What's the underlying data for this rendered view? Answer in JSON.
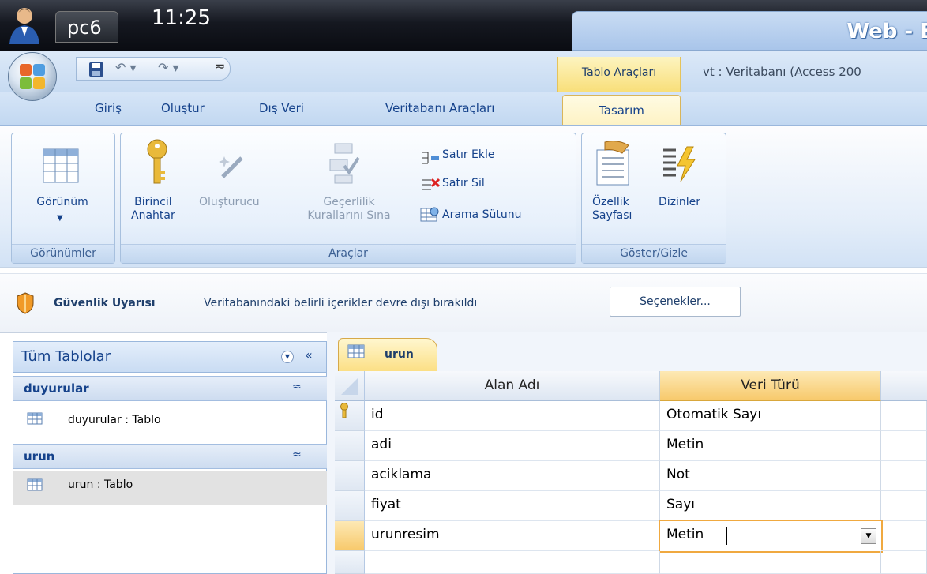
{
  "taskbar": {
    "host": "pc6",
    "clock": "11:25",
    "window_title": "Web - E"
  },
  "titlebar": {
    "context_label": "Tablo Araçları",
    "doc_title": "vt : Veritabanı (Access 200"
  },
  "tabs": {
    "home": "Giriş",
    "create": "Oluştur",
    "external": "Dış Veri",
    "dbtools": "Veritabanı Araçları",
    "design": "Tasarım"
  },
  "ribbon": {
    "view": {
      "label": "Görünüm",
      "group": "Görünümler"
    },
    "tools": {
      "primary_key_1": "Birincil",
      "primary_key_2": "Anahtar",
      "builder": "Oluşturucu",
      "validation_1": "Geçerlilik",
      "validation_2": "Kurallarını Sına",
      "insert_row": "Satır Ekle",
      "delete_row": "Satır Sil",
      "lookup": "Arama Sütunu",
      "group": "Araçlar"
    },
    "showhide": {
      "property_1": "Özellik",
      "property_2": "Sayfası",
      "indexes": "Dizinler",
      "group": "Göster/Gizle"
    }
  },
  "security": {
    "title": "Güvenlik Uyarısı",
    "message": "Veritabanındaki belirli içerikler devre dışı bırakıldı",
    "options": "Seçenekler..."
  },
  "nav": {
    "header": "Tüm Tablolar",
    "groups": [
      {
        "name": "duyurular",
        "item": "duyurular : Tablo"
      },
      {
        "name": "urun",
        "item": "urun : Tablo"
      }
    ]
  },
  "table": {
    "tab": "urun",
    "col_name": "Alan Adı",
    "col_type": "Veri Türü",
    "rows": [
      {
        "name": "id",
        "type": "Otomatik Sayı"
      },
      {
        "name": "adi",
        "type": "Metin"
      },
      {
        "name": "aciklama",
        "type": "Not"
      },
      {
        "name": "fiyat",
        "type": "Sayı"
      },
      {
        "name": "urunresim",
        "type": "Metin"
      }
    ]
  }
}
